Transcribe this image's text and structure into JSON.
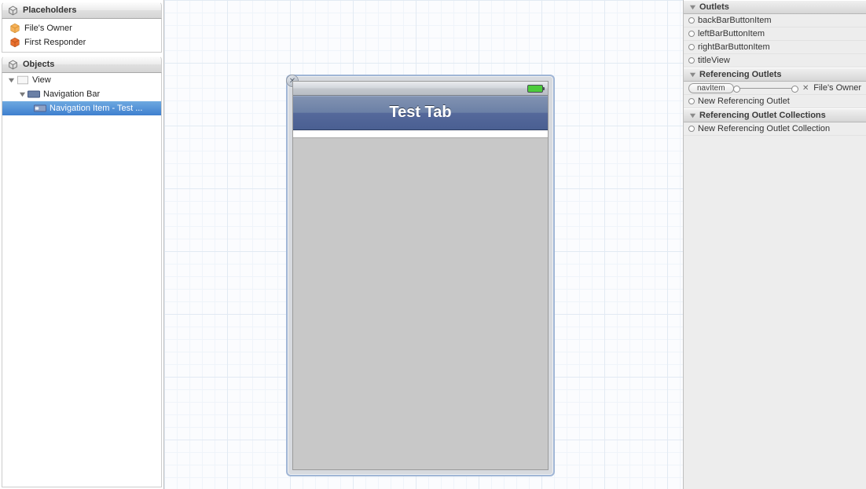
{
  "left": {
    "placeholders_title": "Placeholders",
    "placeholders": [
      {
        "label": "File's Owner"
      },
      {
        "label": "First Responder"
      }
    ],
    "objects_title": "Objects",
    "tree": {
      "view": "View",
      "navbar": "Navigation Bar",
      "navitem": "Navigation Item - Test ..."
    }
  },
  "canvas": {
    "nav_title": "Test Tab"
  },
  "inspector": {
    "outlets_title": "Outlets",
    "outlets": [
      "backBarButtonItem",
      "leftBarButtonItem",
      "rightBarButtonItem",
      "titleView"
    ],
    "ref_outlets_title": "Referencing Outlets",
    "ref_outlet_connection_left": "navItem",
    "ref_outlet_connection_right": "File's Owner",
    "new_ref_outlet": "New Referencing Outlet",
    "ref_collections_title": "Referencing Outlet Collections",
    "new_ref_collection": "New Referencing Outlet Collection"
  }
}
